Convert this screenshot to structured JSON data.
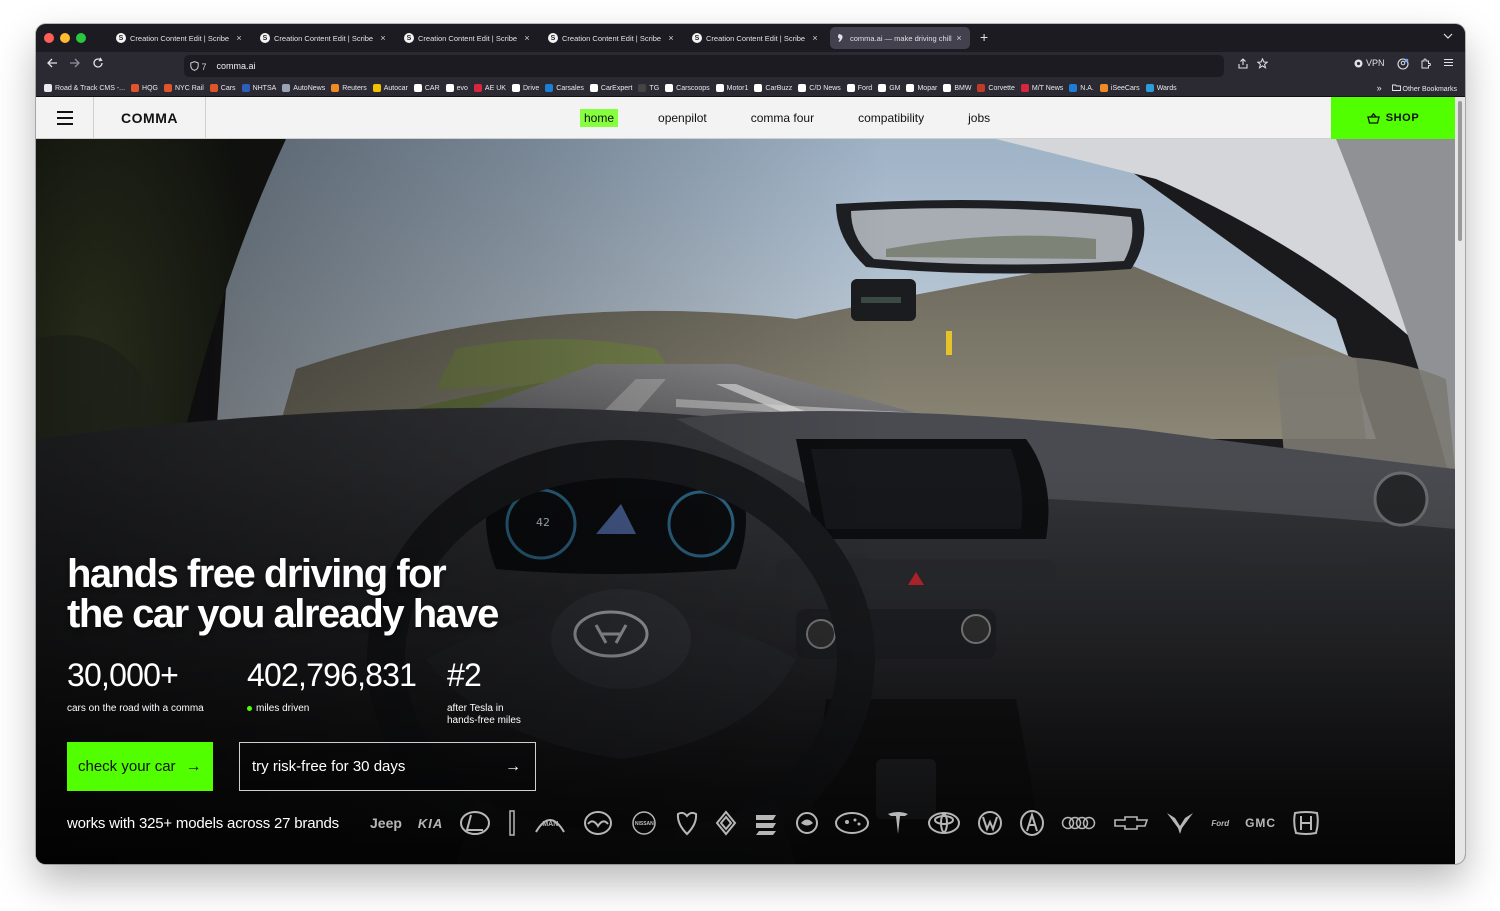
{
  "browser": {
    "tabs": [
      {
        "title": "Creation Content Edit | Scribe",
        "favicon": "S",
        "active": false
      },
      {
        "title": "Creation Content Edit | Scribe",
        "favicon": "S",
        "active": false
      },
      {
        "title": "Creation Content Edit | Scribe",
        "favicon": "S",
        "active": false
      },
      {
        "title": "Creation Content Edit | Scribe",
        "favicon": "S",
        "active": false
      },
      {
        "title": "Creation Content Edit | Scribe",
        "favicon": "S",
        "active": false
      },
      {
        "title": "comma.ai — make driving chill",
        "favicon": "",
        "active": true
      }
    ],
    "tab_close_glyph": "×",
    "new_tab_glyph": "+",
    "address": "comma.ai",
    "tracker_count": "7",
    "vpn_label": "VPN",
    "bookmarks": [
      {
        "label": "Road & Track CMS -...",
        "color": "#e8e8ee"
      },
      {
        "label": "HQG",
        "color": "#e0542c"
      },
      {
        "label": "NYC Rail",
        "color": "#e0542c"
      },
      {
        "label": "Cars",
        "color": "#e0542c"
      },
      {
        "label": "NHTSA",
        "color": "#2d5fb8"
      },
      {
        "label": "AutoNews",
        "color": "#9aa3b5"
      },
      {
        "label": "Reuters",
        "color": "#f08a24"
      },
      {
        "label": "Autocar",
        "color": "#f2c200"
      },
      {
        "label": "CAR",
        "color": "#ffffff"
      },
      {
        "label": "evo",
        "color": "#ffffff"
      },
      {
        "label": "AE UK",
        "color": "#d7263d"
      },
      {
        "label": "Drive",
        "color": "#ffffff"
      },
      {
        "label": "Carsales",
        "color": "#1c7ed6"
      },
      {
        "label": "CarExpert",
        "color": "#ffffff"
      },
      {
        "label": "TG",
        "color": "#444444"
      },
      {
        "label": "Carscoops",
        "color": "#ffffff"
      },
      {
        "label": "Motor1",
        "color": "#ffffff"
      },
      {
        "label": "CarBuzz",
        "color": "#ffffff"
      },
      {
        "label": "C/D News",
        "color": "#ffffff"
      },
      {
        "label": "Ford",
        "color": "#ffffff"
      },
      {
        "label": "GM",
        "color": "#ffffff"
      },
      {
        "label": "Mopar",
        "color": "#ffffff"
      },
      {
        "label": "BMW",
        "color": "#ffffff"
      },
      {
        "label": "Corvette",
        "color": "#c0392b"
      },
      {
        "label": "M/T News",
        "color": "#d7263d"
      },
      {
        "label": "N.A.",
        "color": "#1c7ed6"
      },
      {
        "label": "iSeeCars",
        "color": "#f08a24"
      },
      {
        "label": "Wards",
        "color": "#2d9cdb"
      }
    ],
    "other_bookmarks": "Other Bookmarks",
    "overflow_glyph": "»"
  },
  "site": {
    "logo": "COMMA",
    "nav": [
      {
        "label": "home",
        "current": true
      },
      {
        "label": "openpilot",
        "current": false
      },
      {
        "label": "comma four",
        "current": false
      },
      {
        "label": "compatibility",
        "current": false
      },
      {
        "label": "jobs",
        "current": false
      }
    ],
    "shop_label": "SHOP",
    "accent": "#51ff00"
  },
  "hero": {
    "headline_line1": "hands free driving for",
    "headline_line2": "the car you already have",
    "stats": [
      {
        "value": "30,000+",
        "label": "cars on the road with a comma"
      },
      {
        "value": "402,796,831",
        "label": "miles driven"
      },
      {
        "value": "#2",
        "label_line1": "after Tesla in",
        "label_line2": "hands-free miles"
      }
    ],
    "cta_primary": "check your car",
    "cta_secondary": "try risk-free for 30 days",
    "arrow": "→",
    "brands_label": "works with 325+ models across 27 brands",
    "brands": [
      "Jeep",
      "KIA",
      "Lexus",
      "Lincoln",
      "MAN",
      "Mazda",
      "NISSAN",
      "RAM",
      "Renault",
      "SEAT",
      "Skoda",
      "Subaru",
      "Tesla",
      "Toyota",
      "Volkswagen",
      "Acura",
      "Audi",
      "Chevrolet",
      "Cupra",
      "Ford",
      "GMC",
      "Honda"
    ],
    "dash_speed": "42"
  }
}
